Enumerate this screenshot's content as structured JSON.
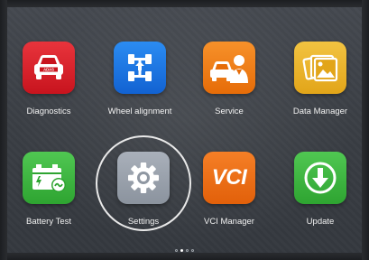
{
  "apps": [
    {
      "label": "Diagnostics",
      "icon": "car-adas-icon",
      "color": "#d8202a",
      "badge": "ADAS"
    },
    {
      "label": "Wheel alignment",
      "icon": "wheel-alignment-icon",
      "color": "#1b7ae6"
    },
    {
      "label": "Service",
      "icon": "service-technician-icon",
      "color": "#f07e14"
    },
    {
      "label": "Data Manager",
      "icon": "photo-gallery-icon",
      "color": "#eab52a"
    },
    {
      "label": "Battery Test",
      "icon": "battery-icon",
      "color": "#3dba3f"
    },
    {
      "label": "Settings",
      "icon": "gear-icon",
      "color": "#9aa2ad",
      "selected": true
    },
    {
      "label": "VCI Manager",
      "icon": "vci-icon",
      "color": "#ef6c12",
      "badge": "VCI"
    },
    {
      "label": "Update",
      "icon": "download-arrow-icon",
      "color": "#3dba3f"
    }
  ],
  "pager": {
    "count": 4,
    "active_index": 1
  }
}
